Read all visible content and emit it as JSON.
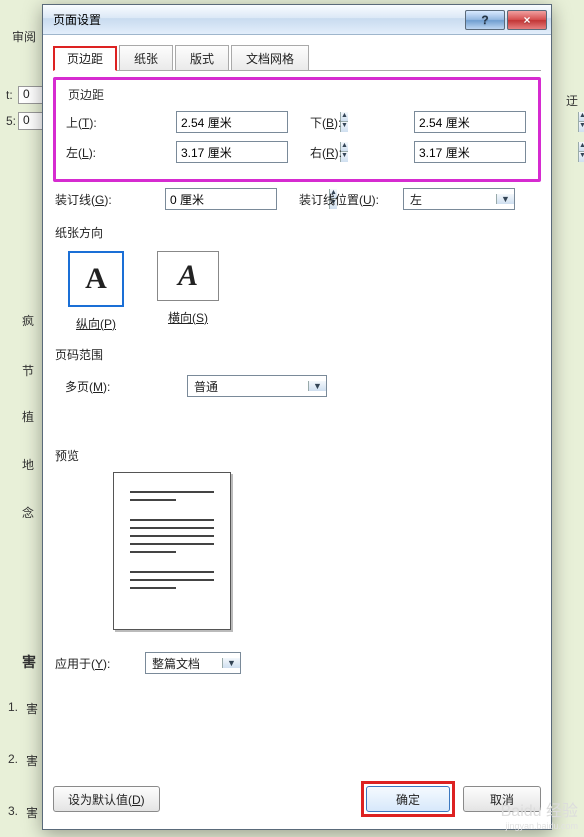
{
  "background": {
    "ribbon_fragment": "审阅",
    "val1": "0",
    "val2": "0",
    "right_char": "迂",
    "left_list": [
      "疯",
      "节",
      "植",
      "地",
      "念",
      "害",
      "害",
      "害",
      "害"
    ],
    "left_nums": [
      "1.",
      "2.",
      "3."
    ]
  },
  "dialog": {
    "title": "页面设置",
    "help_glyph": "?",
    "close_glyph": "×",
    "tabs": [
      "页边距",
      "纸张",
      "版式",
      "文档网格"
    ],
    "margins": {
      "group_label": "页边距",
      "top_label": "上(T):",
      "top_value": "2.54 厘米",
      "bottom_label": "下(B):",
      "bottom_value": "2.54 厘米",
      "left_label": "左(L):",
      "left_value": "3.17 厘米",
      "right_label": "右(R):",
      "right_value": "3.17 厘米"
    },
    "gutter": {
      "label": "装订线(G):",
      "value": "0 厘米",
      "pos_label": "装订线位置(U):",
      "pos_value": "左"
    },
    "orientation": {
      "group_label": "纸张方向",
      "portrait": "纵向(P)",
      "landscape": "横向(S)",
      "glyph": "A"
    },
    "pages": {
      "group_label": "页码范围",
      "multi_label": "多页(M):",
      "multi_value": "普通"
    },
    "preview_label": "预览",
    "apply": {
      "label": "应用于(Y):",
      "value": "整篇文档"
    },
    "buttons": {
      "default": "设为默认值(D)",
      "ok": "确定",
      "cancel": "取消"
    }
  },
  "watermark": {
    "brand": "Baidu 经验",
    "url": "jingyan.baidu.com"
  }
}
